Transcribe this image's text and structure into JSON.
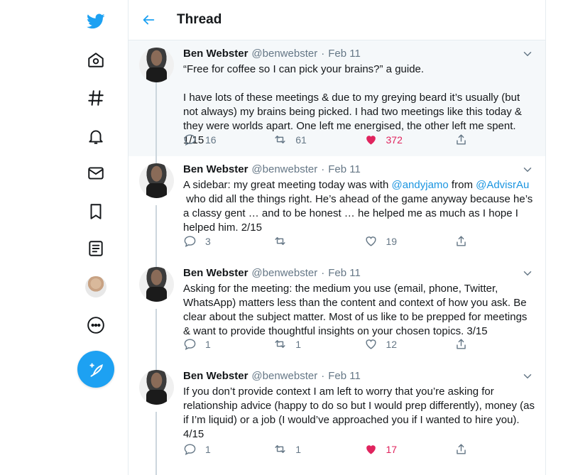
{
  "header": {
    "title": "Thread"
  },
  "nav": {
    "icons": [
      "twitter-logo-icon",
      "home-icon",
      "explore-hashtag-icon",
      "notifications-bell-icon",
      "messages-mail-icon",
      "bookmarks-icon",
      "lists-icon",
      "profile-avatar",
      "more-icon",
      "compose-tweet-icon"
    ]
  },
  "colors": {
    "accent": "#1da1f2",
    "like": "#e0245e",
    "muted": "#657786"
  },
  "tweets": [
    {
      "author": "Ben Webster",
      "handle": "@benwebster",
      "dot": "·",
      "date": "Feb 11",
      "text": "“Free for coffee so I can pick your brains?” a guide.\n\nI have lots of these meetings & due to my greying beard it’s usually (but not always) my brains being picked. I had two meetings like this today & they were worlds apart. One left me energised, the other left me spent. 1/15",
      "replies": "16",
      "retweets": "61",
      "likes": "372"
    },
    {
      "author": "Ben Webster",
      "handle": "@benwebster",
      "dot": "·",
      "date": "Feb 11",
      "text_a": "A sidebar: my great meeting today was with ",
      "mention_1": "@andyjamo",
      "text_b": " from ",
      "mention_2": "@AdvisrAu",
      "text_c": "\n who did all the things right. He’s ahead of the game anyway because he’s a classy gent … and to be honest … he helped me as much as I hope I helped him. 2/15",
      "replies": "3",
      "retweets": "",
      "likes": "19"
    },
    {
      "author": "Ben Webster",
      "handle": "@benwebster",
      "dot": "·",
      "date": "Feb 11",
      "text": "Asking for the meeting: the medium you use (email, phone, Twitter, WhatsApp) matters less than the content and context of how you ask. Be clear about the subject matter. Most of us like to be prepped for meetings & want to provide thoughtful insights on your chosen topics. 3/15",
      "replies": "1",
      "retweets": "1",
      "likes": "12"
    },
    {
      "author": "Ben Webster",
      "handle": "@benwebster",
      "dot": "·",
      "date": "Feb 11",
      "text": "If you don’t provide context I am left to worry that you’re asking for relationship advice (happy to do so but I would prep differently), money (as if I’m liquid) or a job (I would’ve approached you if I wanted to hire you). 4/15",
      "replies": "1",
      "retweets": "1",
      "likes": "17"
    }
  ]
}
